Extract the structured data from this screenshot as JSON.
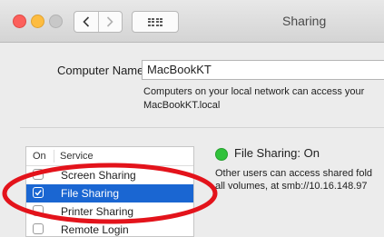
{
  "window": {
    "title": "Sharing"
  },
  "computer_name": {
    "label": "Computer Name:",
    "value": "MacBookKT",
    "help_line1": "Computers on your local network can access your",
    "help_line2": "MacBookKT.local"
  },
  "services": {
    "header_on": "On",
    "header_service": "Service",
    "items": [
      {
        "label": "Screen Sharing",
        "checked": false
      },
      {
        "label": "File Sharing",
        "checked": true,
        "selected": true
      },
      {
        "label": "Printer Sharing",
        "checked": false
      },
      {
        "label": "Remote Login",
        "checked": false
      }
    ]
  },
  "status": {
    "text": "File Sharing: On",
    "desc_line1": "Other users can access shared fold",
    "desc_line2": "all volumes, at smb://10.16.148.97",
    "color": "#30c23b"
  },
  "colors": {
    "selection": "#1a66d2",
    "annotation": "#e3131b"
  },
  "icons": {
    "back": "chevron-left-icon",
    "forward": "chevron-right-icon",
    "show_all": "grid-icon"
  }
}
